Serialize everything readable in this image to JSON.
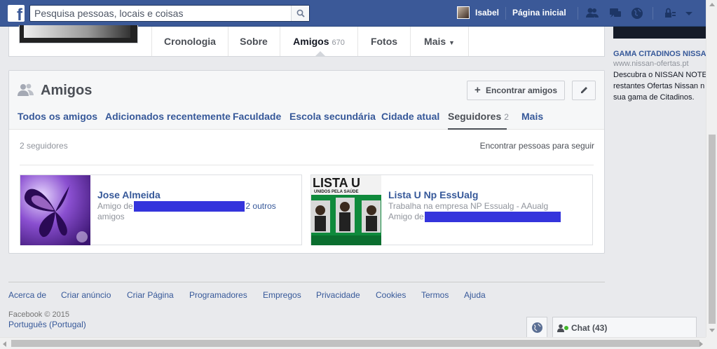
{
  "topbar": {
    "search_placeholder": "Pesquisa pessoas, locais e coisas",
    "user_name": "Isabel",
    "home_label": "Página inicial"
  },
  "profile_tabs": [
    {
      "label": "Cronologia"
    },
    {
      "label": "Sobre"
    },
    {
      "label": "Amigos",
      "count": "670"
    },
    {
      "label": "Fotos"
    },
    {
      "label": "Mais"
    }
  ],
  "friends": {
    "title": "Amigos",
    "find_friends_label": "Encontrar amigos",
    "tabs": [
      {
        "label": "Todos os amigos"
      },
      {
        "label": "Adicionados recentemente"
      },
      {
        "label": "Faculdade"
      },
      {
        "label": "Escola secundária"
      },
      {
        "label": "Cidade atual"
      },
      {
        "label": "Seguidores",
        "count": "2"
      },
      {
        "label": "Mais"
      }
    ],
    "followers_count_text": "2 seguidores",
    "find_people_link": "Encontrar pessoas para seguir",
    "cards": [
      {
        "name": "Jose Almeida",
        "line1_prefix": "Amigo de",
        "line1_suffix": "2 outros",
        "line2": "amigos"
      },
      {
        "name": "Lista U Np EssUalg",
        "line1": "Trabalha na empresa NP Essualg - AAualg",
        "line2_prefix": "Amigo de",
        "cover_title": "LISTA U",
        "cover_subtitle": "UNIDOS PELA SAÚDE"
      }
    ]
  },
  "footer": {
    "links": [
      "Acerca de",
      "Criar anúncio",
      "Criar Página",
      "Programadores",
      "Empregos",
      "Privacidade",
      "Cookies",
      "Termos",
      "Ajuda"
    ],
    "copyright": "Facebook © 2015",
    "language": "Português (Portugal)"
  },
  "ad": {
    "title": "GAMA CITADINOS NISSA",
    "url": "www.nissan-ofertas.pt",
    "body_lines": [
      "Descubra o NISSAN NOTE",
      "restantes Ofertas Nissan n",
      "sua gama de Citadinos."
    ]
  },
  "chat": {
    "label": "Chat (43)"
  },
  "colors": {
    "brand": "#3b5998",
    "link": "#365899",
    "redaction": "#3434dc"
  }
}
